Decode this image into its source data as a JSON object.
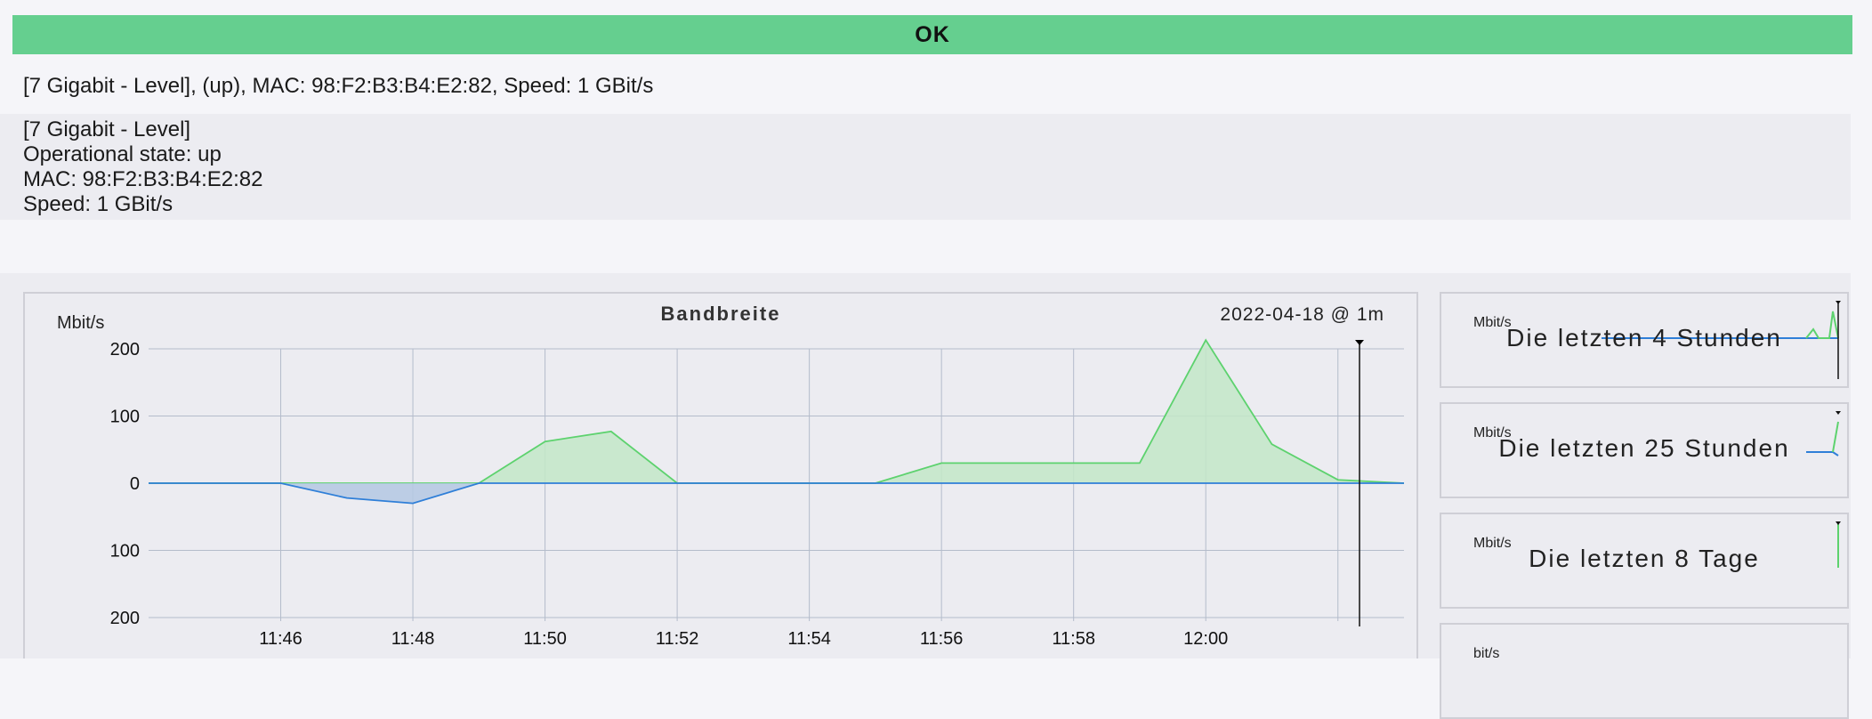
{
  "status": {
    "label": "OK",
    "color": "#65cf8f"
  },
  "summary": "[7 Gigabit - Level], (up), MAC: 98:F2:B3:B4:E2:82, Speed: 1 GBit/s",
  "details": [
    "[7 Gigabit - Level]",
    "Operational state: up",
    "MAC: 98:F2:B3:B4:E2:82",
    "Speed: 1 GBit/s"
  ],
  "main_graph": {
    "title": "Bandbreite",
    "date_label": "2022-04-18 @ 1m",
    "unit": "Mbit/s"
  },
  "thumbnails": [
    {
      "unit": "Mbit/s",
      "label": "Die letzten 4 Stunden"
    },
    {
      "unit": "Mbit/s",
      "label": "Die letzten 25 Stunden"
    },
    {
      "unit": "Mbit/s",
      "label": "Die letzten 8 Tage"
    },
    {
      "unit": "bit/s",
      "label": ""
    }
  ],
  "colors": {
    "in": "#5dd26e",
    "in_fill": "#c3e8c8",
    "out": "#2f7fd8",
    "out_fill": "#b4c8e3",
    "grid": "#b4bccb"
  },
  "chart_data": {
    "type": "area",
    "ylabel": "Mbit/s",
    "ylim": [
      -200,
      200
    ],
    "y_ticks": [
      200,
      100,
      0,
      -100,
      -200
    ],
    "y_tick_labels": [
      "200",
      "100",
      "0",
      "100",
      "200"
    ],
    "x_tick_labels": [
      "11:46",
      "11:48",
      "11:50",
      "11:52",
      "11:54",
      "11:56",
      "11:58",
      "12:00"
    ],
    "x": [
      "11:44",
      "11:45",
      "11:46",
      "11:47",
      "11:48",
      "11:49",
      "11:50",
      "11:51",
      "11:52",
      "11:53",
      "11:54",
      "11:55",
      "11:56",
      "11:57",
      "11:58",
      "11:59",
      "12:00",
      "12:01",
      "12:02",
      "12:03"
    ],
    "series": [
      {
        "values": [
          0,
          0,
          0,
          0,
          0,
          0,
          62,
          77,
          0,
          0,
          0,
          0,
          30,
          30,
          30,
          30,
          213,
          58,
          5,
          0
        ]
      },
      {
        "values": [
          0,
          0,
          0,
          -22,
          -30,
          0,
          0,
          0,
          0,
          0,
          0,
          0,
          0,
          0,
          0,
          0,
          0,
          0,
          0,
          0
        ]
      }
    ],
    "grid": true
  }
}
